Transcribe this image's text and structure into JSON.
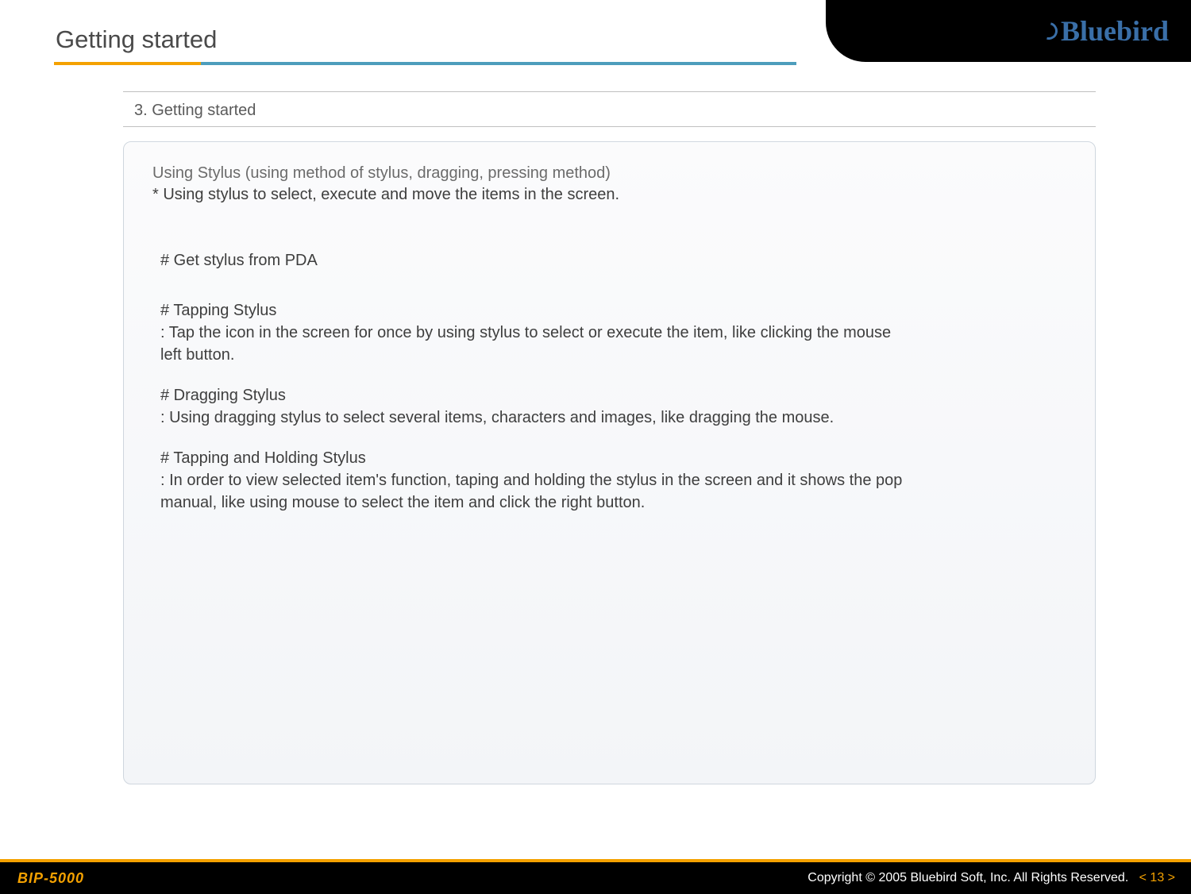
{
  "header": {
    "title": "Getting started",
    "brand": "Bluebird"
  },
  "section": {
    "number_title": "3. Getting started",
    "intro_title": "Using Stylus (using method of stylus, dragging, pressing method)",
    "intro_sub": "* Using stylus to select, execute and move the items in the screen.",
    "items": [
      {
        "head": "# Get stylus from PDA",
        "desc": ""
      },
      {
        "head": "# Tapping Stylus",
        "desc": ": Tap the icon in the screen for once by using stylus to select or execute the item, like clicking the mouse\n  left button."
      },
      {
        "head": "# Dragging Stylus",
        "desc": ": Using dragging stylus to select several items, characters and images, like dragging the mouse."
      },
      {
        "head": "# Tapping and Holding Stylus",
        "desc": ": In order to view selected item's function, taping and holding the stylus in the screen and it shows the pop\n  manual, like using mouse to select the item and click the right button."
      }
    ]
  },
  "footer": {
    "model": "BIP-5000",
    "copyright": "Copyright © 2005 Bluebird Soft, Inc. All Rights Reserved.",
    "page": "< 13 >"
  }
}
